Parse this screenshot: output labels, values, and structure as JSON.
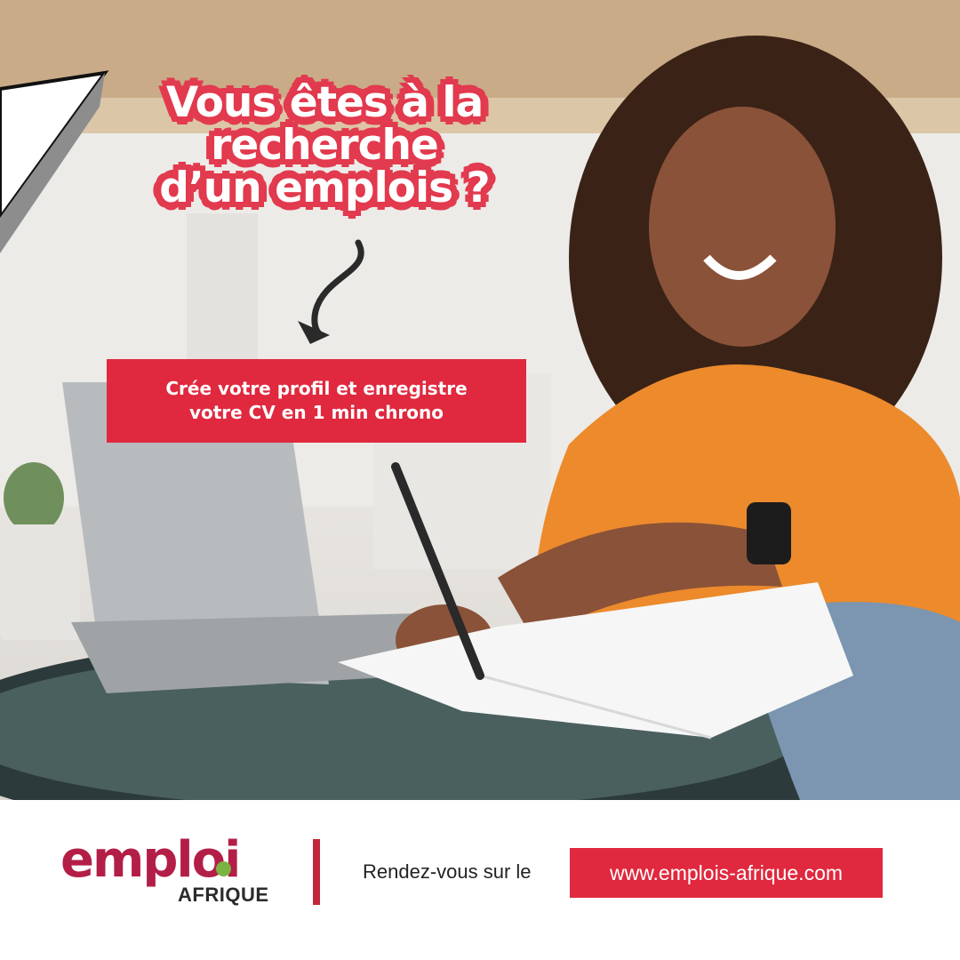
{
  "headline": {
    "line1": "Vous êtes à la",
    "line2": "recherche",
    "line3": "d’un emplois ?"
  },
  "cta": {
    "line1": "Crée votre profil et enregistre",
    "line2": "votre CV en 1 min chrono"
  },
  "footer": {
    "logo_word": "emploi",
    "logo_sub": "AFRIQUE",
    "invite_text": "Rendez-vous sur le",
    "url": "www.emplois-afrique.com"
  },
  "colors": {
    "brand_red": "#e0283e",
    "logo_red": "#b31e47",
    "logo_green": "#7ab342"
  },
  "icons": [
    "paper-plane-icon",
    "curved-arrow-icon"
  ]
}
